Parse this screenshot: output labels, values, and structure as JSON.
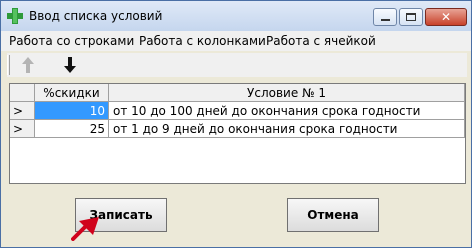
{
  "window": {
    "title": "Ввод списка условий",
    "close_glyph": "✕"
  },
  "menu": {
    "items": [
      "Работа со строками",
      "Работа с колонками",
      "Работа с ячейкой"
    ]
  },
  "toolbar": {
    "up_icon": "arrow-up-icon",
    "down_icon": "arrow-down-icon"
  },
  "grid": {
    "headers": [
      "%скидки",
      "Условие № 1"
    ],
    "rows": [
      {
        "indicator": ">",
        "discount": "10",
        "condition": "от 10 до 100 дней до окончания срока годности"
      },
      {
        "indicator": ">",
        "discount": "25",
        "condition": "от 1 до 9 дней до окончания срока годности"
      }
    ]
  },
  "buttons": {
    "save": "Записать",
    "cancel": "Отмена"
  },
  "colors": {
    "selection": "#3399ff",
    "pointer": "#d0021b"
  }
}
